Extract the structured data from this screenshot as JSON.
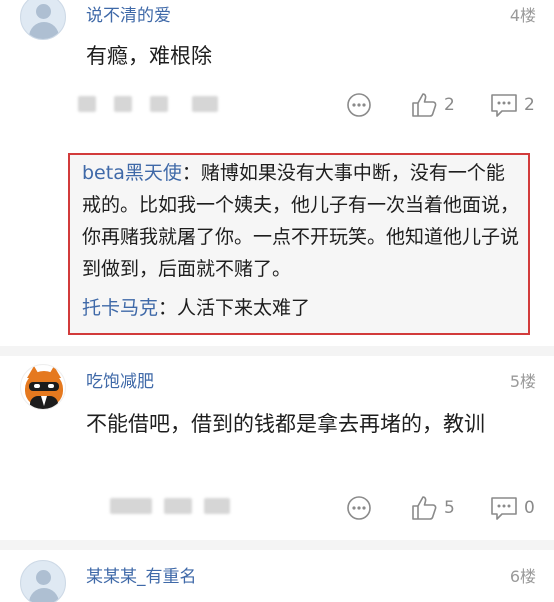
{
  "comments": [
    {
      "username": "说不清的爱",
      "floor": "4楼",
      "text": "有瘾，难根除",
      "likes": "2",
      "replies_count": "2",
      "avatar": "default-person-icon"
    },
    {
      "username": "吃饱减肥",
      "floor": "5楼",
      "text": "不能借吧，借到的钱都是拿去再堵的，教训",
      "likes": "5",
      "replies_count": "0",
      "avatar": "orange-cat-avatar"
    },
    {
      "username": "某某某_有重名",
      "floor": "6楼",
      "avatar": "default-person-icon"
    }
  ],
  "replies": [
    {
      "name": "beta黑天使",
      "separator": "：",
      "text": "赌博如果没有大事中断，没有一个能戒的。比如我一个姨夫，他儿子有一次当着他面说，你再赌我就屠了你。一点不开玩笑。他知道他儿子说到做到，后面就不赌了。"
    },
    {
      "name": "托卡马克",
      "separator": "：",
      "text": "人活下来太难了"
    }
  ],
  "colors": {
    "username": "#3f69a8",
    "highlight_border": "#d23b3b",
    "muted": "#8a8a8a"
  },
  "icons": {
    "more": "more-dots-icon",
    "like": "thumbs-up-icon",
    "reply": "comment-bubble-icon"
  }
}
